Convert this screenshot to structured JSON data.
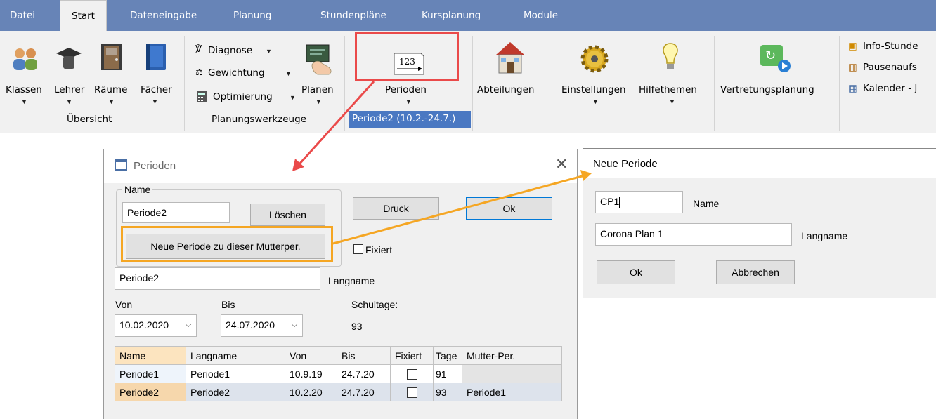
{
  "menu": {
    "tabs": [
      "Datei",
      "Start",
      "Dateneingabe",
      "Planung",
      "Stundenpläne",
      "Kursplanung",
      "Module"
    ],
    "active_tab": "Start"
  },
  "ribbon": {
    "uebersicht": {
      "items": [
        "Klassen",
        "Lehrer",
        "Räume",
        "Fächer"
      ],
      "group_label": "Übersicht"
    },
    "planungswerkzeuge": {
      "diagnose": "Diagnose",
      "gewichtung": "Gewichtung",
      "optimierung": "Optimierung",
      "planen": "Planen",
      "group_label": "Planungswerkzeuge"
    },
    "perioden": {
      "label": "Perioden",
      "icon_text": "123",
      "current": "Periode2 (10.2.-24.7.)"
    },
    "abteilungen": "Abteilungen",
    "einstellungen": "Einstellungen",
    "hilfethemen": "Hilfethemen",
    "vertretungsplanung": "Vertretungsplanung",
    "right_items": [
      "Info-Stunde",
      "Pausenaufs",
      "Kalender - J"
    ]
  },
  "perioden_dialog": {
    "title": "Perioden",
    "name_group_label": "Name",
    "name_value": "Periode2",
    "loeschen": "Löschen",
    "druck": "Druck",
    "ok": "Ok",
    "neue_periode_button": "Neue Periode zu dieser Mutterper.",
    "fixiert": "Fixiert",
    "langname_value": "Periode2",
    "langname_label": "Langname",
    "von_label": "Von",
    "bis_label": "Bis",
    "von_value": "10.02.2020",
    "bis_value": "24.07.2020",
    "schultage_label": "Schultage:",
    "schultage_value": "93",
    "table": {
      "headers": [
        "Name",
        "Langname",
        "Von",
        "Bis",
        "Fixiert",
        "Tage",
        "Mutter-Per."
      ],
      "rows": [
        {
          "name": "Periode1",
          "langname": "Periode1",
          "von": "10.9.19",
          "bis": "24.7.20",
          "fixiert": false,
          "tage": "91",
          "mutter": ""
        },
        {
          "name": "Periode2",
          "langname": "Periode2",
          "von": "10.2.20",
          "bis": "24.7.20",
          "fixiert": false,
          "tage": "93",
          "mutter": "Periode1"
        }
      ]
    }
  },
  "neue_periode_dialog": {
    "title": "Neue Periode",
    "name_value": "CP1",
    "name_label": "Name",
    "langname_value": "Corona Plan 1",
    "langname_label": "Langname",
    "ok": "Ok",
    "abbrechen": "Abbrechen"
  },
  "colors": {
    "menubar": "#6784b7",
    "ribbon": "#f1f1f1",
    "highlight_orange": "#f5a623",
    "highlight_red": "#ea4a4a",
    "selection_blue": "#4a78c2"
  }
}
